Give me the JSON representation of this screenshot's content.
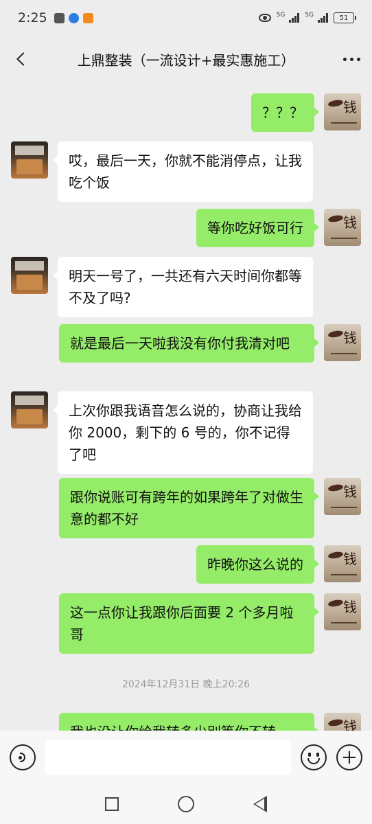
{
  "status_bar": {
    "time": "2:25",
    "net1": "5G",
    "net2": "5G",
    "battery": "51",
    "app_colors": [
      "#555555",
      "#2f7de1",
      "#f28a1e"
    ]
  },
  "header": {
    "back_icon": "chevron-left-icon",
    "title": "上鼎整装（一流设计+最实惠施工）",
    "more_icon": "more-dots-icon"
  },
  "messages": [
    {
      "side": "right",
      "text": "？？？"
    },
    {
      "side": "left",
      "text": "哎，最后一天，你就不能消停点，让我吃个饭"
    },
    {
      "side": "right",
      "text": "等你吃好饭可行"
    },
    {
      "side": "left",
      "text": "明天一号了，一共还有六天时间你都等不及了吗?"
    },
    {
      "side": "right",
      "text": "就是最后一天啦我没有你付我清对吧"
    },
    {
      "side": "left",
      "text": "上次你跟我语音怎么说的，协商让我给你 2000，剩下的 6 号的，你不记得了吧"
    },
    {
      "side": "right",
      "text": "跟你说账可有跨年的如果跨年了对做生意的都不好"
    },
    {
      "side": "right",
      "text": "昨晚你这么说的"
    },
    {
      "side": "right",
      "text": "这一点你让我跟你后面要 2 个多月啦哥"
    },
    {
      "side": "right",
      "text": "我也没让你给我转多少别等你不转"
    }
  ],
  "timestamp": "2024年12月31日 晚上20:26",
  "input_bar": {
    "voice_icon": "voice-icon",
    "input_value": "",
    "emoji_icon": "emoji-icon",
    "plus_icon": "plus-icon"
  },
  "colors": {
    "bubble_self": "#95ec69",
    "bubble_other": "#ffffff",
    "background": "#ededed"
  }
}
